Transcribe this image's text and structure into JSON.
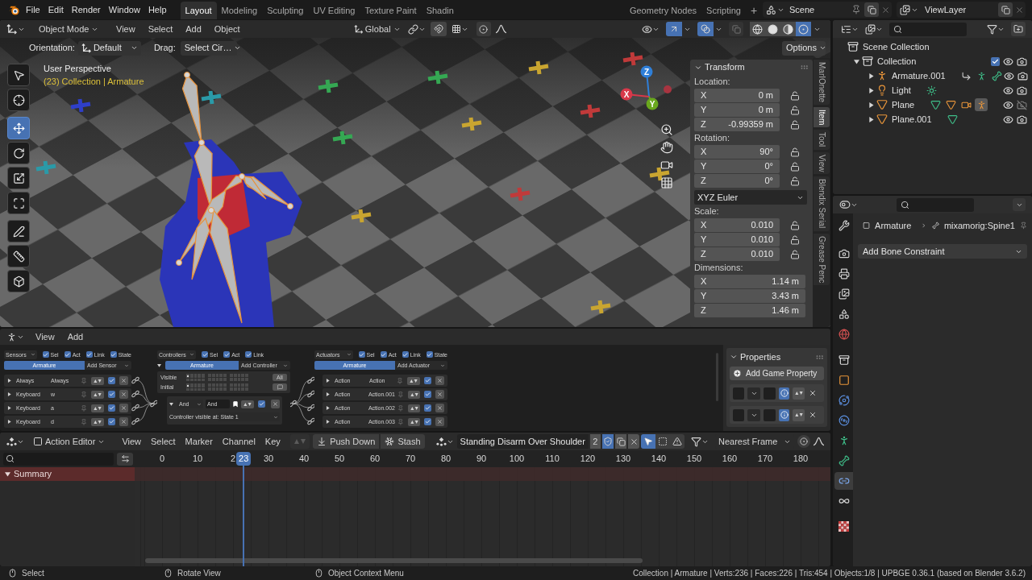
{
  "top_bar": {
    "menus": [
      "File",
      "Edit",
      "Render",
      "Window",
      "Help"
    ],
    "workspaces": [
      {
        "label": "Layout",
        "selected": true
      },
      {
        "label": "Modeling",
        "selected": false
      },
      {
        "label": "Sculpting",
        "selected": false
      },
      {
        "label": "UV Editing",
        "selected": false
      },
      {
        "label": "Texture Paint",
        "selected": false
      },
      {
        "label": "Shadin",
        "selected": false
      },
      {
        "label": "Geometry Nodes",
        "selected": false
      },
      {
        "label": "Scripting",
        "selected": false
      }
    ],
    "add_workspace": "+",
    "scene": "Scene",
    "view_layer": "ViewLayer"
  },
  "viewport": {
    "header": {
      "mode": "Object Mode",
      "menus": [
        "View",
        "Select",
        "Add",
        "Object"
      ],
      "orientation": "Global",
      "gizmos": true,
      "overlays": true,
      "shading": [
        {
          "selected": false
        },
        {
          "selected": false
        },
        {
          "selected": false
        },
        {
          "selected": true
        }
      ]
    },
    "tool_settings": {
      "orientation_label": "Orientation:",
      "orientation": "Default",
      "drag_label": "Drag:",
      "drag": "Select Cir…",
      "options": "Options"
    },
    "tools": [
      {
        "selected": false
      },
      {
        "selected": false
      },
      {
        "selected": true
      },
      {
        "selected": false
      },
      {
        "selected": false
      },
      {
        "selected": false
      },
      {
        "selected": false
      },
      {
        "selected": false
      },
      {
        "selected": false
      }
    ],
    "overlay": {
      "title": "User Perspective",
      "object": "(23) Collection | Armature"
    },
    "gizmo_axes": [
      "Z",
      "X",
      "Y"
    ]
  },
  "sidebar": {
    "panel": "Transform",
    "groups": [
      {
        "label": "Location:",
        "rows": [
          {
            "axis": "X",
            "value": "0 m",
            "locked": false
          },
          {
            "axis": "Y",
            "value": "0 m",
            "locked": false
          },
          {
            "axis": "Z",
            "value": "-0.99359 m",
            "locked": false
          }
        ]
      },
      {
        "label": "Rotation:",
        "rows": [
          {
            "axis": "X",
            "value": "90°",
            "locked": false
          },
          {
            "axis": "Y",
            "value": "0°",
            "locked": false
          },
          {
            "axis": "Z",
            "value": "0°",
            "locked": false
          }
        ],
        "mode": "XYZ Euler"
      },
      {
        "label": "Scale:",
        "rows": [
          {
            "axis": "X",
            "value": "0.010",
            "locked": false
          },
          {
            "axis": "Y",
            "value": "0.010",
            "locked": false
          },
          {
            "axis": "Z",
            "value": "0.010",
            "locked": false
          }
        ]
      },
      {
        "label": "Dimensions:",
        "rows": [
          {
            "axis": "X",
            "value": "1.14 m"
          },
          {
            "axis": "Y",
            "value": "3.43 m"
          },
          {
            "axis": "Z",
            "value": "1.46 m"
          }
        ]
      }
    ],
    "tabs": [
      {
        "label": "MarIOnette",
        "selected": false
      },
      {
        "label": "Item",
        "selected": true
      },
      {
        "label": "Tool",
        "selected": false
      },
      {
        "label": "View",
        "selected": false
      },
      {
        "label": "Blendix Serial",
        "selected": false
      },
      {
        "label": "Grease Penc",
        "selected": false
      }
    ]
  },
  "logic_editor": {
    "menus": [
      "View",
      "Add"
    ],
    "sensors": {
      "title": "Sensors",
      "filters": [
        {
          "label": "Sel",
          "checked": true
        },
        {
          "label": "Act",
          "checked": true
        },
        {
          "label": "Link",
          "checked": true
        },
        {
          "label": "State",
          "checked": true
        }
      ],
      "object": "Armature",
      "add": "Add Sensor",
      "items": [
        {
          "type": "Always",
          "name": "Always",
          "expanded": false,
          "active": true
        },
        {
          "type": "Keyboard",
          "name": "w",
          "expanded": false,
          "active": true
        },
        {
          "type": "Keyboard",
          "name": "a",
          "expanded": false,
          "active": true
        },
        {
          "type": "Keyboard",
          "name": "d",
          "expanded": false,
          "active": true
        }
      ]
    },
    "controllers": {
      "title": "Controllers",
      "filters": [
        {
          "label": "Sel",
          "checked": true
        },
        {
          "label": "Act",
          "checked": true
        },
        {
          "label": "Link",
          "checked": true
        }
      ],
      "object_expanded": true,
      "object": "Armature",
      "add": "Add Controller",
      "state_rows": [
        {
          "label": "Visible",
          "state_1": true
        },
        {
          "label": "Initial",
          "state_1": true
        }
      ],
      "all": "All",
      "items": [
        {
          "type": "And",
          "name": "And",
          "expanded": true,
          "active": true,
          "visible_label": "Controller visible at:",
          "state": "State 1"
        }
      ]
    },
    "actuators": {
      "title": "Actuators",
      "filters": [
        {
          "label": "Sel",
          "checked": true
        },
        {
          "label": "Act",
          "checked": true
        },
        {
          "label": "Link",
          "checked": true
        },
        {
          "label": "State",
          "checked": true
        }
      ],
      "object": "Armature",
      "add": "Add Actuator",
      "items": [
        {
          "type": "Action",
          "name": "Action",
          "expanded": false,
          "active": true
        },
        {
          "type": "Action",
          "name": "Action.001",
          "expanded": false,
          "active": true
        },
        {
          "type": "Action",
          "name": "Action.002",
          "expanded": false,
          "active": true
        },
        {
          "type": "Action",
          "name": "Action.003",
          "expanded": false,
          "active": true
        }
      ]
    },
    "properties": {
      "title": "Properties",
      "add": "Add Game Property",
      "items": [
        {
          "debug": true
        },
        {
          "debug": true
        }
      ]
    }
  },
  "action_editor": {
    "mode": "Action Editor",
    "menus": [
      "View",
      "Select",
      "Marker",
      "Channel",
      "Key"
    ],
    "push_down": "Push Down",
    "stash": "Stash",
    "action": "Standing Disarm Over Shoulder",
    "users": "2",
    "fake_user": true,
    "only_selected": true,
    "snapping": "Nearest Frame",
    "frames": [
      "0",
      "10",
      "2",
      "30",
      "40",
      "50",
      "60",
      "70",
      "80",
      "90",
      "100",
      "110",
      "120",
      "130",
      "140",
      "150",
      "160",
      "170",
      "180"
    ],
    "current_frame": "23",
    "channels": [
      {
        "label": "Summary",
        "expanded": true
      }
    ]
  },
  "outliner": {
    "tree": [
      {
        "label": "Scene Collection",
        "kind": "scene",
        "selected": false,
        "children": [
          {
            "label": "Collection",
            "kind": "collection",
            "selected": false,
            "expanded": true,
            "checked": true,
            "visible": true,
            "renderable": true,
            "children": [
              {
                "label": "Armature.001",
                "kind": "armature",
                "selected": false,
                "expanded": false,
                "visible": true,
                "renderable": true,
                "children": [
                  {
                    "kind": "animation",
                    "selected": false
                  },
                  {
                    "kind": "pose",
                    "selected": false
                  },
                  {
                    "kind": "armature_data",
                    "selected": false
                  }
                ]
              },
              {
                "label": "Light",
                "kind": "light",
                "selected": false,
                "expanded": false,
                "visible": true,
                "renderable": true,
                "children": [
                  {
                    "kind": "light_data",
                    "selected": false
                  }
                ]
              },
              {
                "label": "Plane",
                "kind": "mesh",
                "selected": false,
                "expanded": false,
                "visible": true,
                "renderable": false,
                "children": [
                  {
                    "kind": "mesh_data",
                    "selected": false
                  },
                  {
                    "kind": "mesh_object",
                    "selected": false
                  },
                  {
                    "kind": "camera_object",
                    "selected": false
                  },
                  {
                    "kind": "armature_object",
                    "selected": true
                  }
                ]
              },
              {
                "label": "Plane.001",
                "kind": "mesh",
                "selected": false,
                "expanded": false,
                "visible": true,
                "renderable": true,
                "children": [
                  {
                    "kind": "mesh_data",
                    "selected": false
                  }
                ]
              }
            ]
          }
        ]
      }
    ]
  },
  "properties_editor": {
    "tabs": [
      {
        "selected": false
      },
      {
        "selected": false
      },
      {
        "selected": false
      },
      {
        "selected": false
      },
      {
        "selected": false
      },
      {
        "selected": false
      },
      {
        "selected": false
      },
      {
        "selected": false
      },
      {
        "selected": false
      },
      {
        "selected": false
      },
      {
        "selected": false
      },
      {
        "selected": false
      },
      {
        "selected": true
      },
      {
        "selected": false
      },
      {
        "selected": false
      }
    ],
    "breadcrumb": [
      "Armature",
      "mixamorig:Spine1"
    ],
    "add_constraint": "Add Bone Constraint"
  },
  "status_bar": {
    "hints": [
      "Select",
      "Rotate View",
      "Object Context Menu"
    ],
    "stats": "Collection | Armature | Verts:236 | Faces:226 | Tris:454 | Objects:1/8 | UPBGE 0.36.1 (based on Blender 3.6.2)"
  }
}
